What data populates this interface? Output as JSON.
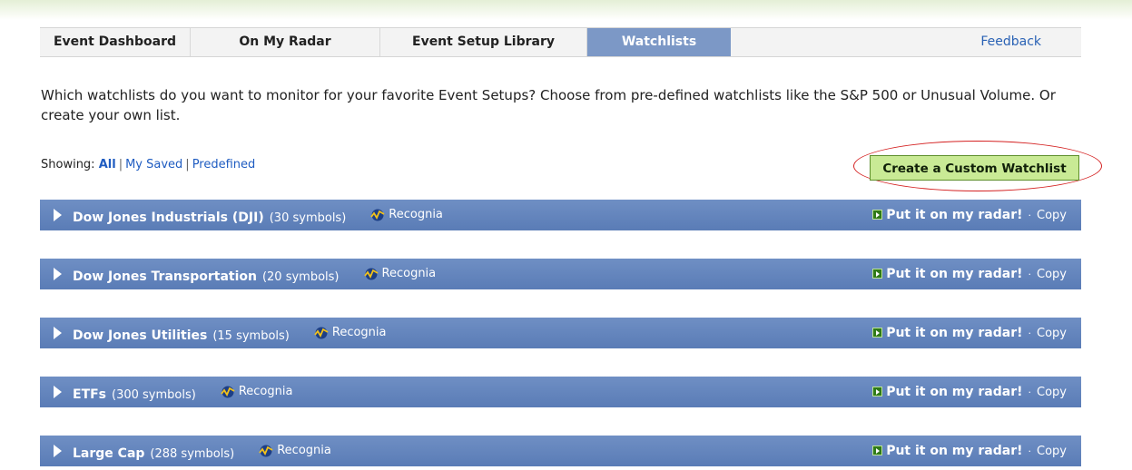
{
  "nav": {
    "tabs": [
      {
        "label": "Event Dashboard"
      },
      {
        "label": "On My Radar"
      },
      {
        "label": "Event Setup Library"
      },
      {
        "label": "Watchlists",
        "active": true
      }
    ],
    "feedback": "Feedback"
  },
  "intro": "Which watchlists do you want to monitor for your favorite Event Setups? Choose from pre-defined watchlists like the S&P 500 or Unusual Volume. Or create your own list.",
  "filter": {
    "label": "Showing:",
    "all": "All",
    "my_saved": "My Saved",
    "predefined": "Predefined",
    "separator": "|"
  },
  "create_button": "Create a Custom Watchlist",
  "rows": [
    {
      "name": "Dow Jones Industrials (DJI)",
      "count": "(30 symbols)",
      "provider": "Recognia",
      "radar": "Put it on my radar!",
      "dot": "·",
      "copy": "Copy"
    },
    {
      "name": "Dow Jones Transportation",
      "count": "(20 symbols)",
      "provider": "Recognia",
      "radar": "Put it on my radar!",
      "dot": "·",
      "copy": "Copy"
    },
    {
      "name": "Dow Jones Utilities",
      "count": "(15 symbols)",
      "provider": "Recognia",
      "radar": "Put it on my radar!",
      "dot": "·",
      "copy": "Copy"
    },
    {
      "name": "ETFs",
      "count": "(300 symbols)",
      "provider": "Recognia",
      "radar": "Put it on my radar!",
      "dot": "·",
      "copy": "Copy"
    },
    {
      "name": "Large Cap",
      "count": "(288 symbols)",
      "provider": "Recognia",
      "radar": "Put it on my radar!",
      "dot": "·",
      "copy": "Copy"
    }
  ],
  "colors": {
    "active_tab": "#7c98c6",
    "row_bar": "#5a7cb6",
    "create_button": "#c9ea95",
    "highlight_oval": "#d42020",
    "link": "#1f5cc1"
  }
}
